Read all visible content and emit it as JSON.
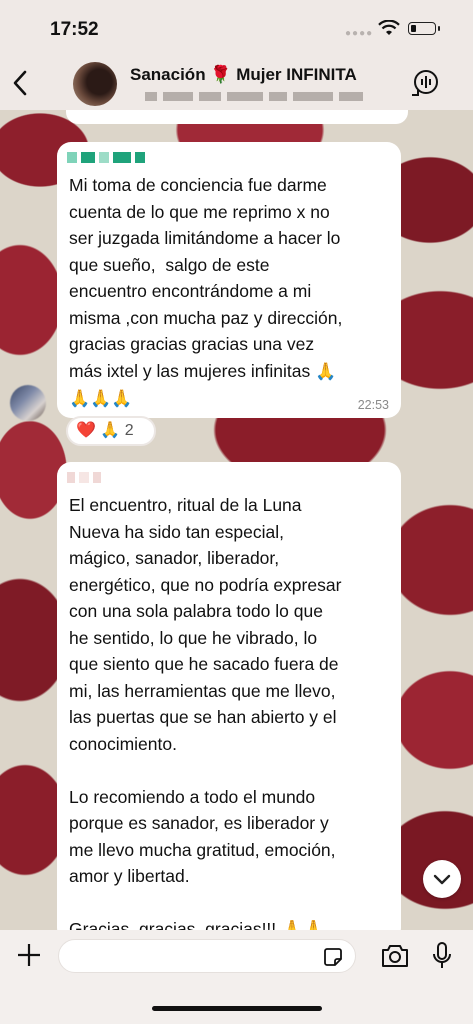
{
  "status_bar": {
    "time": "17:52"
  },
  "header": {
    "title": "Sanación 🌹 Mujer INFINITA"
  },
  "messages": [
    {
      "text": "Mi toma de conciencia fue darme\ncuenta de lo que me reprimo x no\nser juzgada limitándome a hacer lo\nque sueño,  salgo de este\nencuentro encontrándome a mi\nmisma ,con mucha paz y dirección,\ngracias gracias gracias una vez\nmás ixtel y las mujeres infinitas ",
      "emojis_inline": "🙏",
      "emojis_line": "🙏🙏🙏",
      "time": "22:53",
      "reaction": {
        "emojis": "❤️ 🙏",
        "count": "2"
      }
    },
    {
      "text": "El encuentro, ritual de la Luna\nNueva ha sido tan especial,\nmágico, sanador, liberador,\nenergético, que no podría expresar\ncon una sola palabra todo lo que\nhe sentido, lo que he vibrado, lo\nque siento que he sacado fuera de\nmi, las herramientas que me llevo,\nlas puertas que se han abierto y el\nconocimiento.\n\nLo recomiendo a todo el mundo\nporque es sanador, es liberador y\nme llevo mucha gratitud, emoción,\namor y libertad.\n\nGracias, gracias, gracias!!! 🙏🙏"
    }
  ],
  "colors": {
    "bubble": "#ffffff",
    "header_bg": "#efe9e6",
    "sender_blur": "#1fa37b"
  },
  "icons": [
    "back-chevron-icon",
    "group-call-icon",
    "plus-icon",
    "sticker-icon",
    "camera-icon",
    "microphone-icon",
    "chevron-down-icon",
    "wifi-icon",
    "battery-icon"
  ]
}
